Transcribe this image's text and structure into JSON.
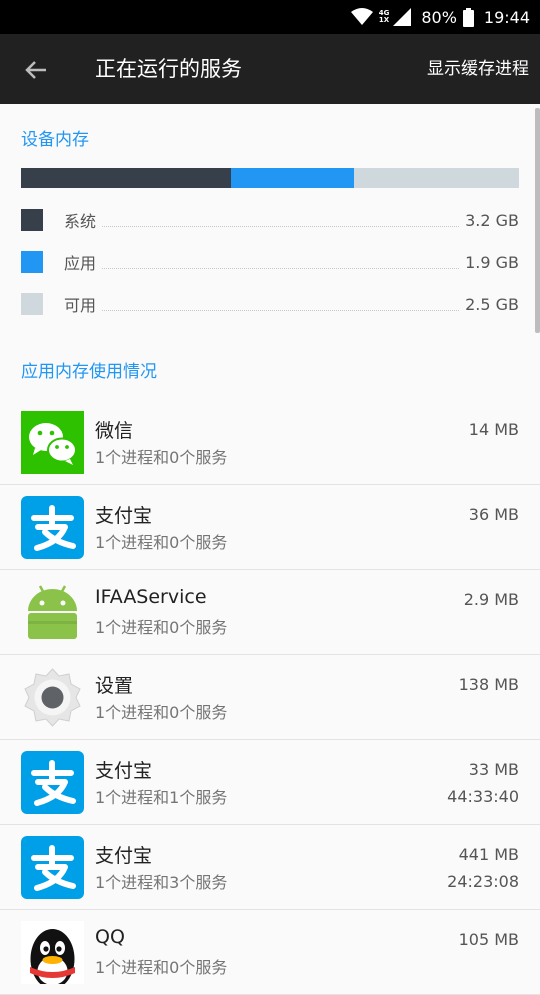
{
  "status_bar": {
    "network_top": "4G",
    "network_bottom": "1X",
    "battery": "80%",
    "time": "19:44"
  },
  "app_bar": {
    "title": "正在运行的服务",
    "action": "显示缓存进程",
    "back_icon": "arrow-back-icon"
  },
  "device_memory": {
    "title": "设备内存",
    "bar": {
      "system_fraction": 0.422,
      "apps_fraction": 0.247,
      "free_fraction": 0.331
    },
    "items": [
      {
        "label": "系统",
        "value": "3.2 GB",
        "color": "#37404a"
      },
      {
        "label": "应用",
        "value": "1.9 GB",
        "color": "#2196f3"
      },
      {
        "label": "可用",
        "value": "2.5 GB",
        "color": "#cfd8dc"
      }
    ]
  },
  "app_memory": {
    "title": "应用内存使用情况",
    "apps": [
      {
        "name": "微信",
        "detail": "1个进程和0个服务",
        "size": "14 MB",
        "time": "",
        "icon": "wechat-icon"
      },
      {
        "name": "支付宝",
        "detail": "1个进程和0个服务",
        "size": "36 MB",
        "time": "",
        "icon": "alipay-icon"
      },
      {
        "name": "IFAAService",
        "detail": "1个进程和0个服务",
        "size": "2.9 MB",
        "time": "",
        "icon": "android-icon"
      },
      {
        "name": "设置",
        "detail": "1个进程和0个服务",
        "size": "138 MB",
        "time": "",
        "icon": "settings-gear-icon"
      },
      {
        "name": "支付宝",
        "detail": "1个进程和1个服务",
        "size": "33 MB",
        "time": "44:33:40",
        "icon": "alipay-icon"
      },
      {
        "name": "支付宝",
        "detail": "1个进程和3个服务",
        "size": "441 MB",
        "time": "24:23:08",
        "icon": "alipay-icon"
      },
      {
        "name": "QQ",
        "detail": "1个进程和0个服务",
        "size": "105 MB",
        "time": "",
        "icon": "qq-penguin-icon"
      }
    ]
  },
  "colors": {
    "accent": "#2196f3",
    "app_bar": "#212121",
    "wechat_green": "#2dc100",
    "alipay_blue": "#00a0e9",
    "android_green": "#8bc34a"
  }
}
